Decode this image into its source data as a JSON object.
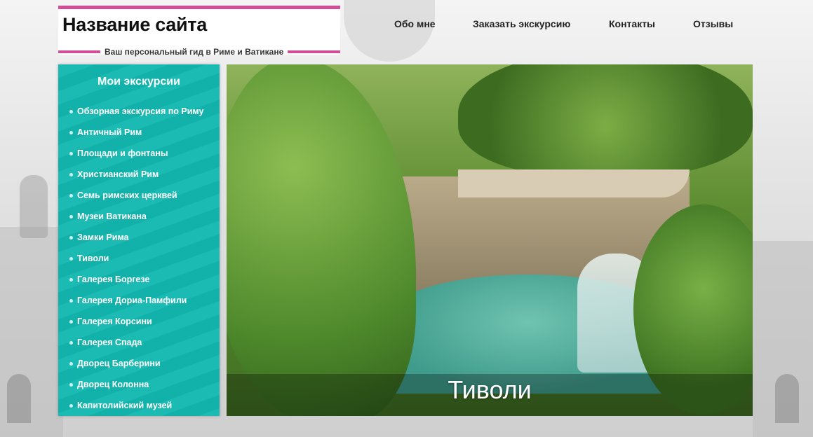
{
  "header": {
    "site_title": "Название сайта",
    "tagline": "Ваш персональный гид в Риме и Ватикане"
  },
  "nav": {
    "items": [
      {
        "label": "Обо мне"
      },
      {
        "label": "Заказать экскурсию"
      },
      {
        "label": "Контакты"
      },
      {
        "label": "Отзывы"
      }
    ]
  },
  "sidebar": {
    "title": "Мои экскурсии",
    "items": [
      {
        "label": "Обзорная экскурсия по Риму"
      },
      {
        "label": "Античный Рим"
      },
      {
        "label": "Площади и фонтаны"
      },
      {
        "label": "Христианский Рим"
      },
      {
        "label": "Семь римских церквей"
      },
      {
        "label": "Музеи Ватикана"
      },
      {
        "label": "Замки Рима"
      },
      {
        "label": "Тиволи"
      },
      {
        "label": "Галерея Боргезе"
      },
      {
        "label": "Галерея Дориа-Памфили"
      },
      {
        "label": "Галерея Корсини"
      },
      {
        "label": "Галерея Спада"
      },
      {
        "label": "Дворец Барберини"
      },
      {
        "label": "Дворец Колонна"
      },
      {
        "label": "Капитолийский музей"
      }
    ]
  },
  "hero": {
    "caption": "Тиволи"
  },
  "colors": {
    "accent_pink": "#d14f96",
    "sidebar_teal": "#12b7b0"
  }
}
